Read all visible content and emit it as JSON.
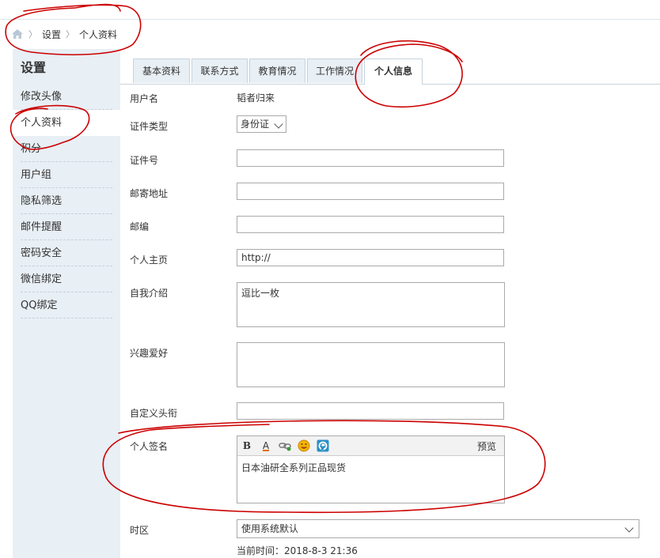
{
  "breadcrumb": {
    "home_icon": "home-icon",
    "items": [
      "设置",
      "个人资料"
    ]
  },
  "sidebar": {
    "title": "设置",
    "items": [
      "修改头像",
      "个人资料",
      "积分",
      "用户组",
      "隐私筛选",
      "邮件提醒",
      "密码安全",
      "微信绑定",
      "QQ绑定"
    ],
    "active_index": 1
  },
  "tabs": {
    "items": [
      "基本资料",
      "联系方式",
      "教育情况",
      "工作情况",
      "个人信息"
    ],
    "active_index": 4
  },
  "form": {
    "username": {
      "label": "用户名",
      "value": "韬者归来"
    },
    "id_type": {
      "label": "证件类型",
      "value": "身份证"
    },
    "id_number": {
      "label": "证件号",
      "value": ""
    },
    "address": {
      "label": "邮寄地址",
      "value": ""
    },
    "zipcode": {
      "label": "邮编",
      "value": ""
    },
    "homepage": {
      "label": "个人主页",
      "value": "http://"
    },
    "bio": {
      "label": "自我介绍",
      "value": "逗比一枚"
    },
    "hobbies": {
      "label": "兴趣爱好",
      "value": ""
    },
    "custom_title": {
      "label": "自定义头衔",
      "value": ""
    },
    "signature": {
      "label": "个人签名",
      "toolbar": {
        "bold": "B",
        "font_color": "A",
        "link_icon": "link-icon",
        "smiley_icon": "smiley-icon",
        "image_icon": "image-icon",
        "preview": "预览"
      },
      "value": "日本油研全系列正品现货"
    },
    "timezone": {
      "label": "时区",
      "value": "使用系统默认",
      "current_time": "当前时间：2018-8-3 21:36"
    }
  },
  "colors": {
    "annotation": "#cc0000",
    "sidebar_bg": "#e8eff5",
    "border": "#c8d3dc"
  }
}
